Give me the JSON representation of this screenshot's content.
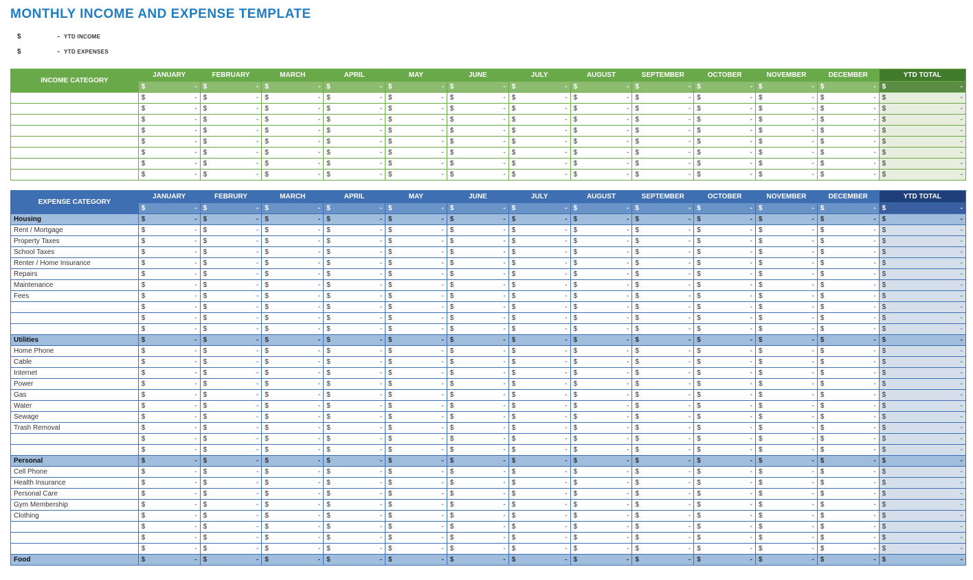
{
  "title": "MONTHLY INCOME AND EXPENSE TEMPLATE",
  "summary": [
    {
      "symbol": "$",
      "value": "-",
      "label": "YTD INCOME"
    },
    {
      "symbol": "$",
      "value": "-",
      "label": "YTD EXPENSES"
    }
  ],
  "months": [
    "JANUARY",
    "FEBRUARY",
    "MARCH",
    "APRIL",
    "MAY",
    "JUNE",
    "JULY",
    "AUGUST",
    "SEPTEMBER",
    "OCTOBER",
    "NOVEMBER",
    "DECEMBER"
  ],
  "months_expense": [
    "JANUARY",
    "FEBRURY",
    "MARCH",
    "APRIL",
    "MAY",
    "JUNE",
    "JULY",
    "AUGUST",
    "SEPTEMBER",
    "OCTOBER",
    "NOVEMBER",
    "DECEMBER"
  ],
  "ytd_label": "YTD TOTAL",
  "dollar": "$",
  "dash": "-",
  "income": {
    "corner": "INCOME CATEGORY",
    "rows": [
      "",
      "",
      "",
      "",
      "",
      "",
      "",
      ""
    ]
  },
  "expense": {
    "corner": "EXPENSE CATEGORY",
    "sections": [
      {
        "name": "Housing",
        "items": [
          "Rent / Mortgage",
          "Property Taxes",
          "School Taxes",
          "Renter / Home Insurance",
          "Repairs",
          "Maintenance",
          "Fees",
          "",
          "",
          ""
        ]
      },
      {
        "name": "Utilities",
        "items": [
          "Home Phone",
          "Cable",
          "Internet",
          "Power",
          "Gas",
          "Water",
          "Sewage",
          "Trash Removal",
          "",
          ""
        ]
      },
      {
        "name": "Personal",
        "items": [
          "Cell Phone",
          "Health Insurance",
          "Personal Care",
          "Gym Membership",
          "Clothing",
          "",
          "",
          ""
        ]
      },
      {
        "name": "Food",
        "items": []
      }
    ]
  }
}
